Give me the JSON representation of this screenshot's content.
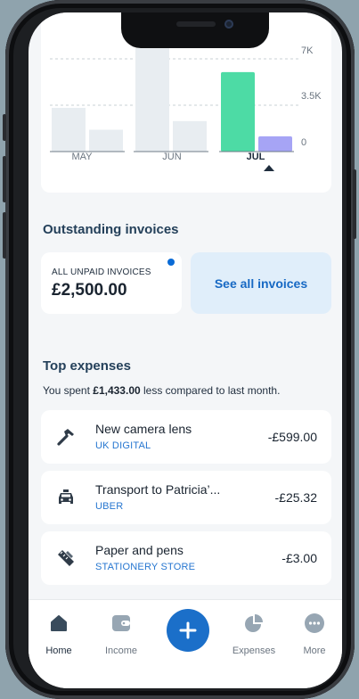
{
  "chart_data": {
    "type": "bar",
    "categories": [
      "MAY",
      "JUN",
      "JUL"
    ],
    "series": [
      {
        "values": [
          3300,
          1650
        ],
        "note": "may"
      },
      {
        "values": [
          7800,
          2300
        ],
        "note": "jun"
      },
      {
        "values": [
          6000,
          1150
        ],
        "note": "jul"
      }
    ],
    "y_ticks": [
      "7K",
      "3.5K",
      "0"
    ],
    "ylim": [
      0,
      7000
    ],
    "selected": "JUL",
    "colors": {
      "income": "#4ddba5",
      "expense": "#a6a4f5",
      "inactive": "#e8edf1"
    }
  },
  "outstanding": {
    "title": "Outstanding invoices",
    "unpaid_label": "ALL UNPAID INVOICES",
    "unpaid_amount": "£2,500.00",
    "see_all": "See all invoices"
  },
  "top_expenses": {
    "title": "Top expenses",
    "spent_prefix": "You spent ",
    "spent_amount": "£1,433.00",
    "spent_suffix": " less compared to last month.",
    "items": [
      {
        "name": "New camera lens",
        "vendor": "UK DIGITAL",
        "amount": "-£599.00",
        "icon": "hammer-icon"
      },
      {
        "name": "Transport to Patricia’...",
        "vendor": "UBER",
        "amount": "-£25.32",
        "icon": "taxi-icon"
      },
      {
        "name": "Paper and pens",
        "vendor": "STATIONERY STORE",
        "amount": "-£3.00",
        "icon": "ruler-pencil-icon"
      }
    ]
  },
  "tabs": [
    {
      "label": "Home",
      "icon": "home-icon"
    },
    {
      "label": "Income",
      "icon": "wallet-icon"
    },
    {
      "label": "",
      "icon": "plus-icon"
    },
    {
      "label": "Expenses",
      "icon": "pie-chart-icon"
    },
    {
      "label": "More",
      "icon": "more-icon"
    }
  ]
}
